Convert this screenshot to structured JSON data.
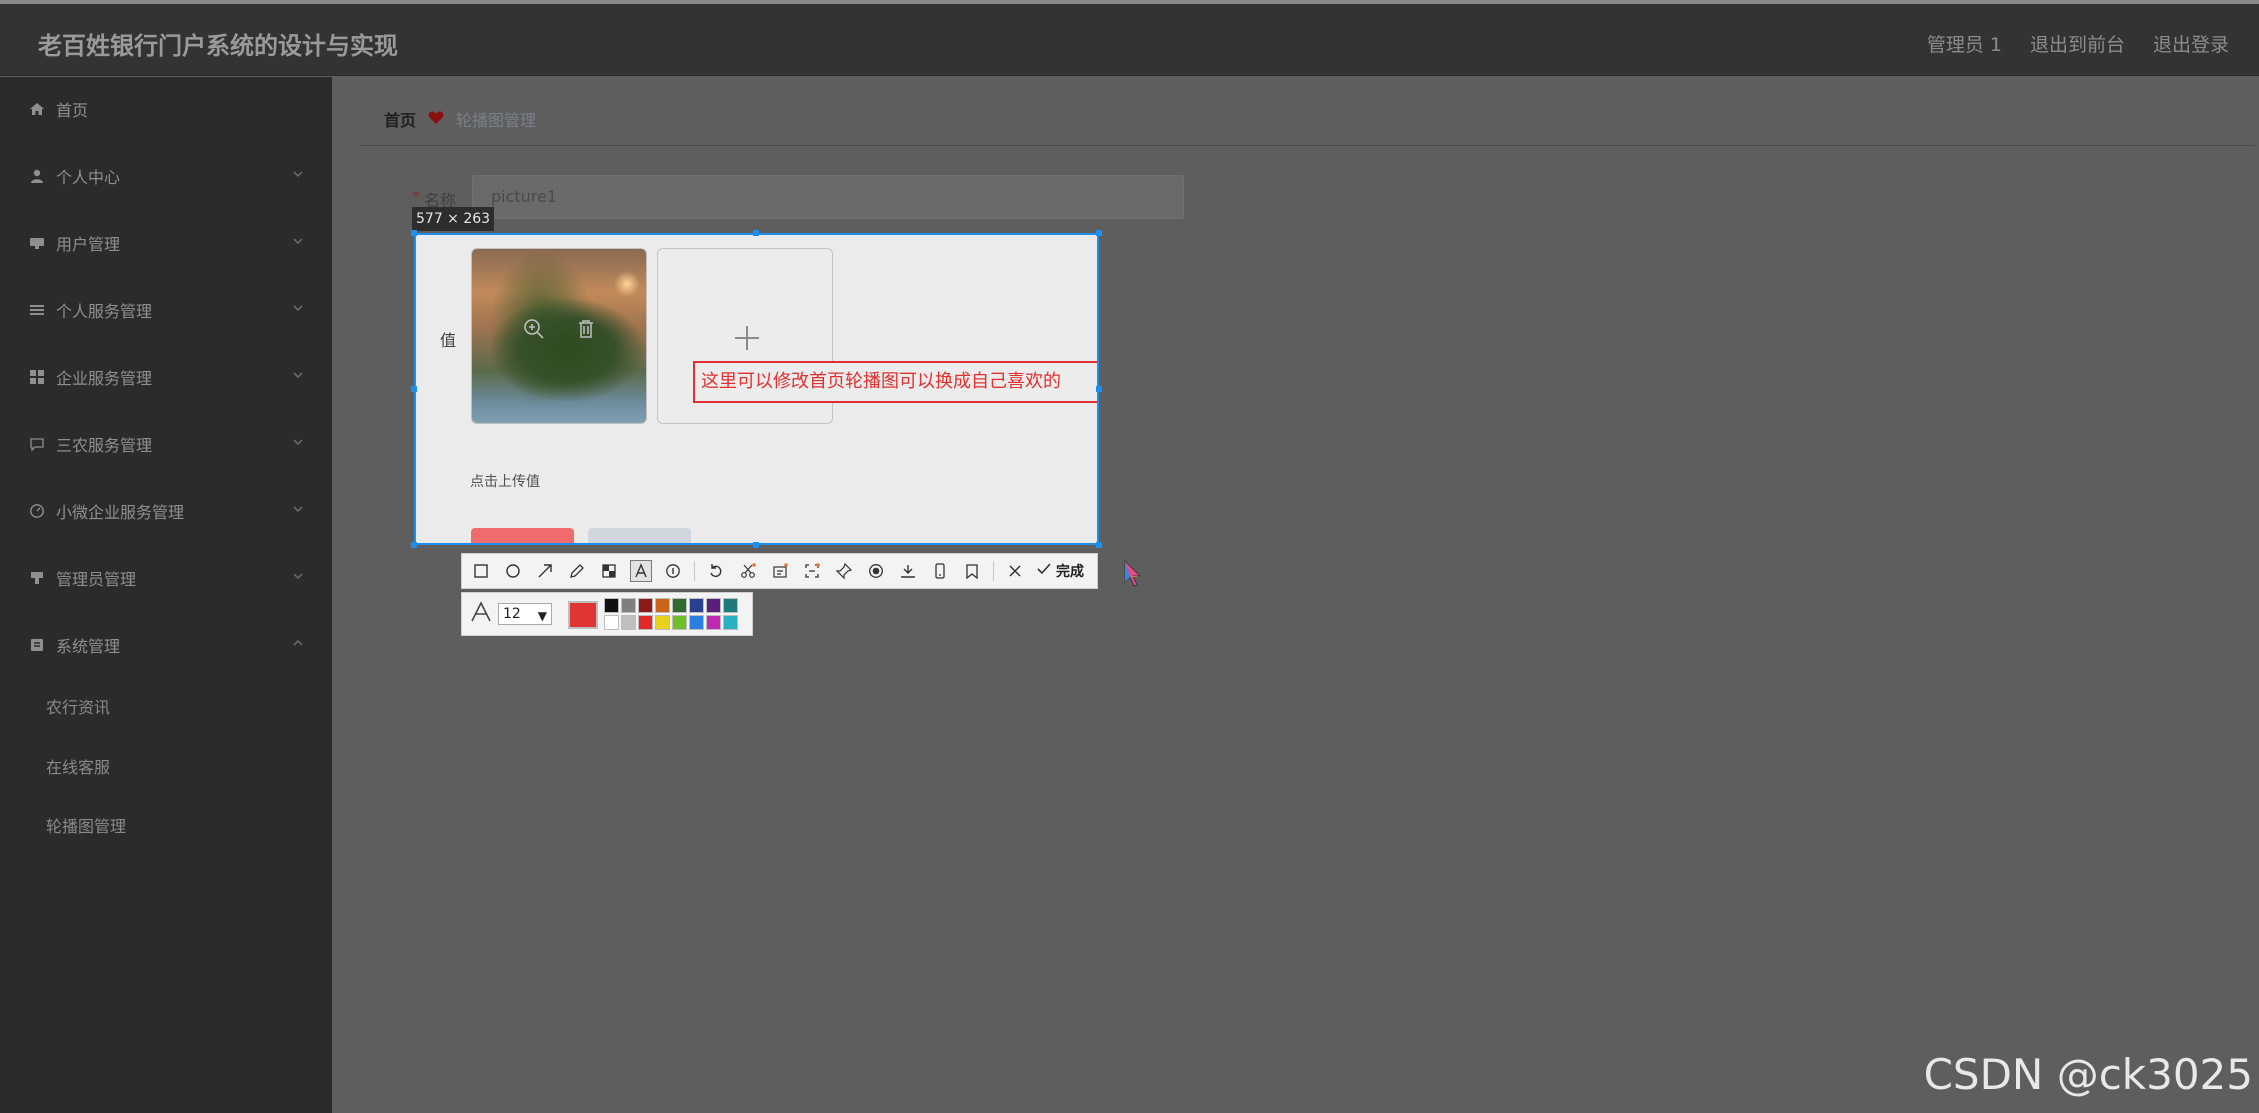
{
  "header": {
    "title": "老百姓银行门户系统的设计与实现",
    "links": [
      "管理员 1",
      "退出到前台",
      "退出登录"
    ]
  },
  "sidebar": {
    "items": [
      {
        "label": "首页",
        "icon": "home-icon",
        "has_chevron": false
      },
      {
        "label": "个人中心",
        "icon": "user-icon",
        "has_chevron": true
      },
      {
        "label": "用户管理",
        "icon": "users-icon",
        "has_chevron": true
      },
      {
        "label": "个人服务管理",
        "icon": "list-icon",
        "has_chevron": true
      },
      {
        "label": "企业服务管理",
        "icon": "grid-icon",
        "has_chevron": true
      },
      {
        "label": "三农服务管理",
        "icon": "chat-icon",
        "has_chevron": true
      },
      {
        "label": "小微企业服务管理",
        "icon": "dashboard-icon",
        "has_chevron": true
      },
      {
        "label": "管理员管理",
        "icon": "admin-icon",
        "has_chevron": true
      },
      {
        "label": "系统管理",
        "icon": "system-icon",
        "has_chevron": true,
        "expanded": true
      }
    ],
    "sub_items": [
      "农行资讯",
      "在线客服",
      "轮播图管理"
    ]
  },
  "breadcrumb": {
    "home": "首页",
    "current": "轮播图管理"
  },
  "form": {
    "name_required_mark": "*",
    "name_label": "名称",
    "name_value": "picture1",
    "value_label": "值",
    "upload_hint": "点击上传值"
  },
  "screenshot_tool": {
    "size_label": "577 × 263",
    "annotation_text": "这里可以修改首页轮播图可以换成自己喜欢的",
    "done_label": "完成",
    "font_size": "12",
    "current_color": "#e03535",
    "palette_colors": [
      "#111111",
      "#7f7f7f",
      "#8b1a1a",
      "#c8651b",
      "#2f6b2f",
      "#2b3f8f",
      "#5a1f7a",
      "#1f7a7a",
      "#ffffff",
      "#bfbfbf",
      "#e02a2a",
      "#e8d21c",
      "#6fbf2a",
      "#2a7fe0",
      "#c02ab0",
      "#2ab0c0"
    ]
  },
  "watermark": "CSDN @ck3025"
}
